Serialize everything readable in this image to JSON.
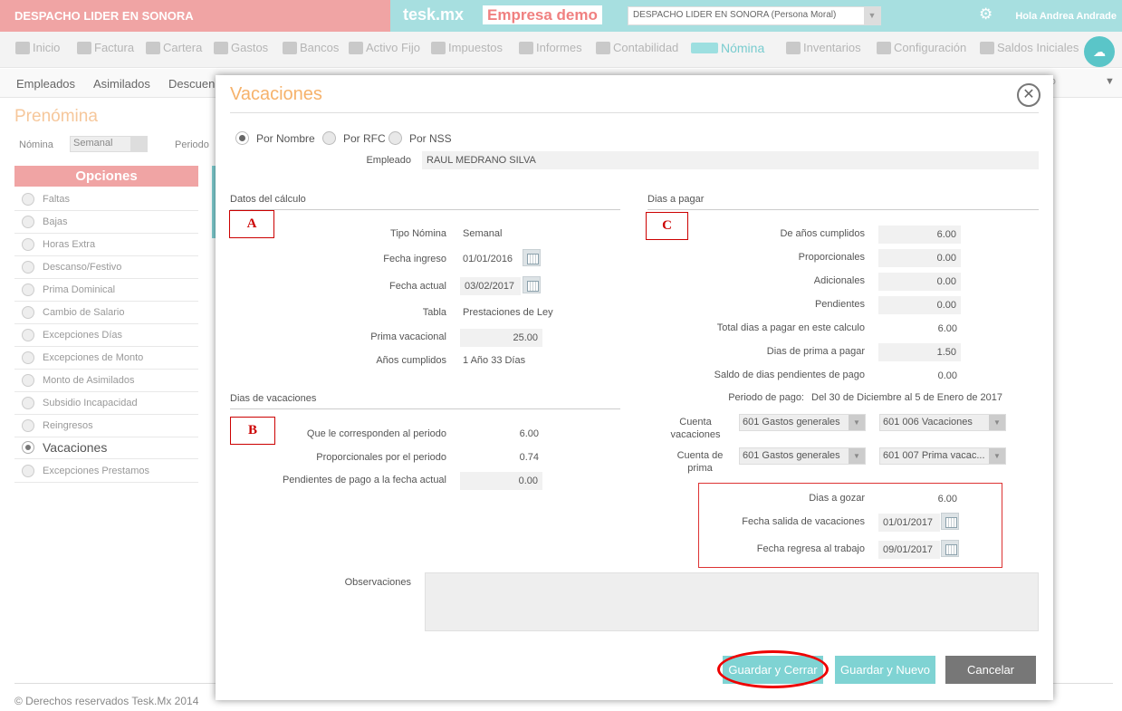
{
  "topbar": {
    "company": "DESPACHO LIDER EN SONORA",
    "brand": "tesk.mx",
    "empresa": "Empresa demo",
    "company_select": "DESPACHO LIDER EN SONORA  (Persona Moral)",
    "greeting": "Hola Andrea Andrade"
  },
  "nav": [
    "Inicio",
    "Factura",
    "Cartera",
    "Gastos",
    "Bancos",
    "Activo Fijo",
    "Impuestos",
    "Informes",
    "Contabilidad",
    "Nómina",
    "Inventarios",
    "Configuración",
    "Saldos Iniciales"
  ],
  "subnav": [
    "Empleados",
    "Asimilados",
    "Descuen"
  ],
  "subnav_select": "ero",
  "page": {
    "title": "Prenómina",
    "nomina_label": "Nómina",
    "nomina_value": "Semanal",
    "periodo_label": "Periodo"
  },
  "opciones": {
    "header": "Opciones",
    "items": [
      "Faltas",
      "Bajas",
      "Horas Extra",
      "Descanso/Festivo",
      "Prima Dominical",
      "Cambio de Salario",
      "Excepciones Días",
      "Excepciones de Monto",
      "Monto de Asimilados",
      "Subsidio Incapacidad",
      "Reingresos",
      "Vacaciones",
      "Excepciones Prestamos"
    ],
    "selected": "Vacaciones"
  },
  "footer": "© Derechos reservados Tesk.Mx 2014",
  "modal": {
    "title": "Vacaciones",
    "radios": [
      "Por Nombre",
      "Por RFC",
      "Por NSS"
    ],
    "radio_selected": "Por Nombre",
    "empleado_label": "Empleado",
    "empleado_value": "RAUL MEDRANO SILVA",
    "sec_calculo": "Datos del cálculo",
    "sec_vacaciones": "Dias de vacaciones",
    "sec_pagar": "Dias a pagar",
    "marker_a": "A",
    "marker_b": "B",
    "marker_c": "C",
    "calc": {
      "tipo_label": "Tipo Nómina",
      "tipo_value": "Semanal",
      "ingreso_label": "Fecha ingreso",
      "ingreso_value": "01/01/2016",
      "actual_label": "Fecha actual",
      "actual_value": "03/02/2017",
      "tabla_label": "Tabla",
      "tabla_value": "Prestaciones de Ley",
      "prima_label": "Prima vacacional",
      "prima_value": "25.00",
      "anios_label": "Años cumplidos",
      "anios_value": "1 Año 33 Días"
    },
    "vac": {
      "corresponden_label": "Que le corresponden al periodo",
      "corresponden_value": "6.00",
      "proporcionales_label": "Proporcionales por el periodo",
      "proporcionales_value": "0.74",
      "pendientes_label": "Pendientes de pago a la fecha actual",
      "pendientes_value": "0.00"
    },
    "pagar": {
      "anios_label": "De años cumplidos",
      "anios_value": "6.00",
      "prop_label": "Proporcionales",
      "prop_value": "0.00",
      "adic_label": "Adicionales",
      "adic_value": "0.00",
      "pend_label": "Pendientes",
      "pend_value": "0.00",
      "total_label": "Total dias a pagar en este calculo",
      "total_value": "6.00",
      "prima_label": "Dias de prima a pagar",
      "prima_value": "1.50",
      "saldo_label": "Saldo de dias pendientes de pago",
      "saldo_value": "0.00",
      "periodo_label": "Periodo de pago:",
      "periodo_value": "Del 30 de Diciembre al 5 de Enero de 2017",
      "cuenta_vac_label": "Cuenta vacaciones",
      "cuenta_vac_1": "601 Gastos generales",
      "cuenta_vac_2": "601 006 Vacaciones",
      "cuenta_prima_label": "Cuenta de prima",
      "cuenta_prima_1": "601 Gastos generales",
      "cuenta_prima_2": "601 007 Prima vacac...",
      "gozar_label": "Dias a gozar",
      "gozar_value": "6.00",
      "salida_label": "Fecha salida de vacaciones",
      "salida_value": "01/01/2017",
      "regresa_label": "Fecha regresa al trabajo",
      "regresa_value": "09/01/2017"
    },
    "obs_label": "Observaciones",
    "buttons": {
      "save_close": "Guardar y Cerrar",
      "save_new": "Guardar y Nuevo",
      "cancel": "Cancelar"
    }
  }
}
